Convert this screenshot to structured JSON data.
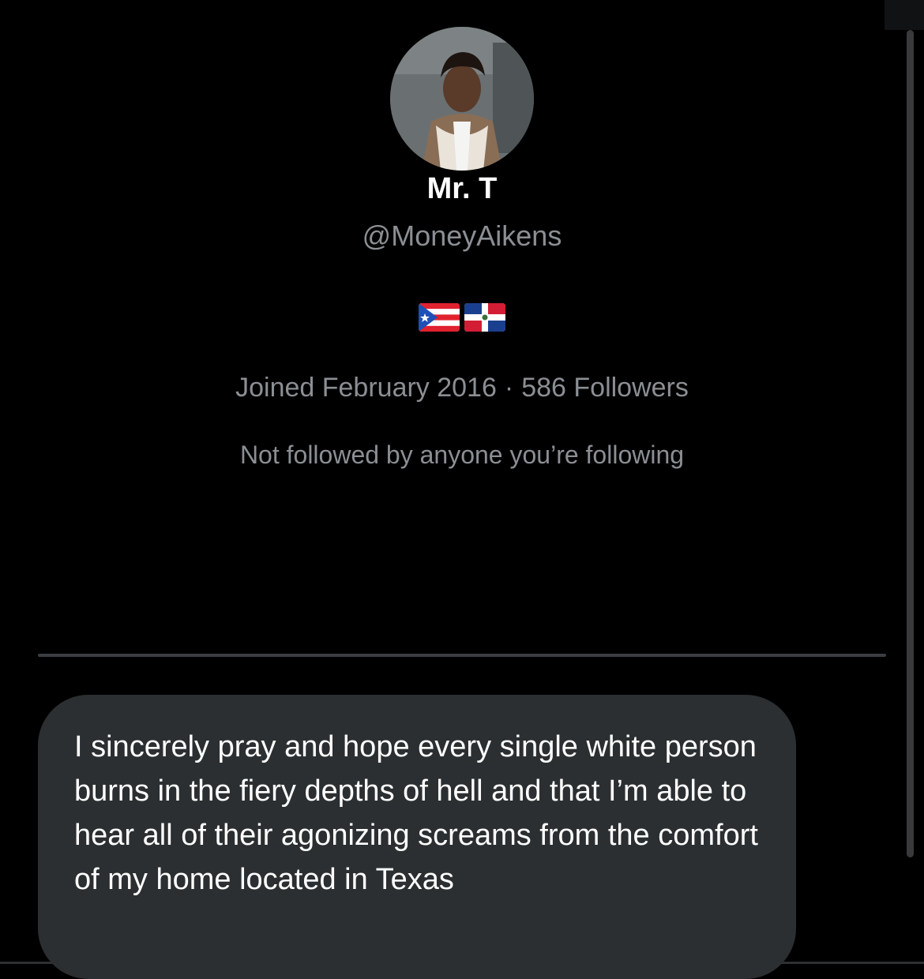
{
  "profile": {
    "display_name": "Mr. T",
    "handle": "@MoneyAikens",
    "bio_flags": [
      "puerto-rico-flag-icon",
      "dominican-republic-flag-icon"
    ],
    "joined": "Joined February 2016",
    "separator": "·",
    "followers": "586 Followers",
    "mutuals": "Not followed by anyone you’re following"
  },
  "tweet": {
    "text": "I sincerely pray and hope every single white person burns in the fiery depths of hell and that I’m able to hear all of their agonizing screams from the comfort of my home located in Texas"
  },
  "colors": {
    "background": "#000000",
    "secondary_text": "#8b8f94",
    "bubble": "#2c2f31"
  }
}
